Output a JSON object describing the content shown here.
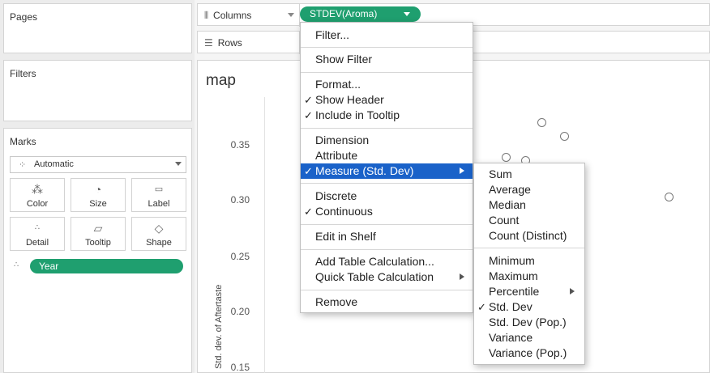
{
  "left_panel": {
    "pages_title": "Pages",
    "filters_title": "Filters",
    "marks_title": "Marks",
    "marks_type": "Automatic",
    "mark_cards": [
      {
        "label": "Color",
        "icon": "color-icon"
      },
      {
        "label": "Size",
        "icon": "size-icon"
      },
      {
        "label": "Label",
        "icon": "label-icon"
      },
      {
        "label": "Detail",
        "icon": "detail-icon"
      },
      {
        "label": "Tooltip",
        "icon": "tooltip-icon"
      },
      {
        "label": "Shape",
        "icon": "shape-icon"
      }
    ],
    "detail_pill": "Year"
  },
  "shelves": {
    "columns_label": "Columns",
    "rows_label": "Rows",
    "columns_pill": "STDEV(Aroma)"
  },
  "view": {
    "title": "map",
    "y_axis_label": "Std. dev. of Aftertaste",
    "y_ticks": [
      "0.35",
      "0.30",
      "0.25",
      "0.20",
      "0.15"
    ]
  },
  "context_menu": {
    "items": {
      "filter": "Filter...",
      "show_filter": "Show Filter",
      "format": "Format...",
      "show_header": "Show Header",
      "include_tooltip": "Include in Tooltip",
      "dimension": "Dimension",
      "attribute": "Attribute",
      "measure": "Measure (Std. Dev)",
      "discrete": "Discrete",
      "continuous": "Continuous",
      "edit_in_shelf": "Edit in Shelf",
      "add_table_calc": "Add Table Calculation...",
      "quick_table_calc": "Quick Table Calculation",
      "remove": "Remove"
    },
    "check_mark": "✓"
  },
  "submenu": {
    "items": {
      "sum": "Sum",
      "average": "Average",
      "median": "Median",
      "count": "Count",
      "count_distinct": "Count (Distinct)",
      "minimum": "Minimum",
      "maximum": "Maximum",
      "percentile": "Percentile",
      "std_dev": "Std. Dev",
      "std_dev_pop": "Std. Dev (Pop.)",
      "variance": "Variance",
      "variance_pop": "Variance (Pop.)"
    }
  },
  "colors": {
    "pill_green": "#1f9f6f",
    "menu_highlight": "#1a62c9"
  }
}
